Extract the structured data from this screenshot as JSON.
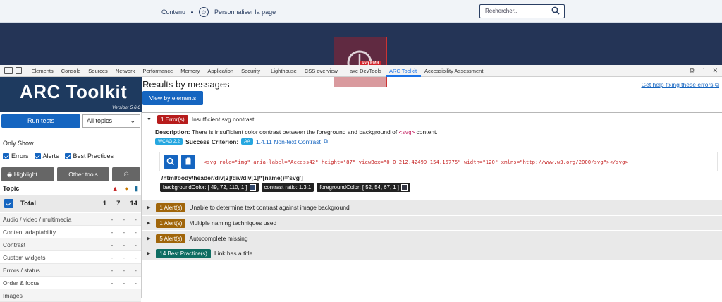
{
  "site": {
    "menu_content": "Contenu",
    "menu_personalize": "Personnaliser la page",
    "search_placeholder": "Rechercher...",
    "err_tag": "svg ERR"
  },
  "devtools": {
    "tabs": [
      "Elements",
      "Console",
      "Sources",
      "Network",
      "Performance",
      "Memory",
      "Application",
      "Security",
      "Lighthouse",
      "CSS overview",
      "axe DevTools",
      "ARC Toolkit",
      "Accessibility Assessment"
    ],
    "active_tab": "ARC Toolkit"
  },
  "sidebar": {
    "brand": "ARC Toolkit",
    "version": "Version: 5.6.0",
    "run_tests": "Run tests",
    "topics_select": "All topics",
    "only_show": "Only Show",
    "filter_errors": "Errors",
    "filter_alerts": "Alerts",
    "filter_bp": "Best Practices",
    "highlight": "Highlight",
    "other_tools": "Other tools",
    "topic_header": "Topic",
    "total_label": "Total",
    "total_errors": "1",
    "total_alerts": "7",
    "total_bp": "14",
    "categories": [
      "Audio / video / multimedia",
      "Content adaptability",
      "Contrast",
      "Custom widgets",
      "Errors / status",
      "Order & focus",
      "Images"
    ],
    "dash": "-"
  },
  "main": {
    "title": "Results by messages",
    "view_by_elements": "View by elements",
    "help_link": "Get help fixing these errors",
    "group1": {
      "badge": "1 Error(s)",
      "text": "Insufficient svg contrast"
    },
    "description_label": "Description:",
    "description": "There is insufficient color contrast between the foreground and background of",
    "description_code": "<svg>",
    "description_end": "content.",
    "wcag": "WCAG 2.2",
    "success_label": "Success Criterion:",
    "aa": "AA",
    "criterion": "1.4.11 Non-text Contrast",
    "code": "<svg role=\"img\" aria-label=\"Access42\" height=\"87\" viewBox=\"0 0 212.42499 154.15775\" width=\"120\" xmlns=\"http://www.w3.org/2000/svg\"></svg>",
    "xpath": "/html/body/header/div[2]/div/div[1]/*[name()='svg']",
    "chip_bg": "backgroundColor: [ 49, 72, 110, 1 ]",
    "chip_ratio": "contrast ratio: 1.3:1",
    "chip_fg": "foregroundColor: [ 52, 54, 67, 1 ]",
    "groups": [
      {
        "badge": "1 Alert(s)",
        "text": "Unable to determine text contrast against image background",
        "kind": "alert"
      },
      {
        "badge": "1 Alert(s)",
        "text": "Multiple naming techniques used",
        "kind": "alert"
      },
      {
        "badge": "5 Alert(s)",
        "text": "Autocomplete missing",
        "kind": "alert"
      },
      {
        "badge": "14 Best Practice(s)",
        "text": "Link has a title",
        "kind": "bp"
      }
    ]
  },
  "colors": {
    "bg_swatch": "#31486e",
    "fg_swatch": "#343643"
  }
}
